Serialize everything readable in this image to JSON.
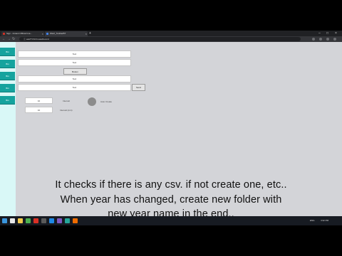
{
  "browser": {
    "tabs": [
      {
        "title": "Sign - Instant Official Ima...",
        "favicon_color": "#d93025"
      },
      {
        "title": "Wet2_ToolbarBT",
        "favicon_color": "#4285f4"
      }
    ],
    "new_tab_glyph": "+",
    "close_glyph": "×",
    "window_controls": [
      "–",
      "□",
      "×"
    ],
    "address": "ⓘ ask/ITCN/CreateRecord",
    "nav_glyphs": [
      "←",
      "→",
      "↻"
    ]
  },
  "app": {
    "sidebar": {
      "buttons": [
        "Btn",
        "Btn",
        "Btn",
        "Btn",
        "Btn"
      ],
      "accent": "#15a39e",
      "background": "#d9f8f7"
    },
    "fields": [
      "Text",
      "Text",
      "Text",
      "Text"
    ],
    "middle_button": "Button",
    "side_button": "Send",
    "small_fields": [
      {
        "value": "10",
        "label": "Interval"
      },
      {
        "value": "10",
        "label": "Interval (min)"
      }
    ],
    "indicator_label": "Auto Create"
  },
  "caption": {
    "lines": [
      "It checks if there is any csv. if not create one, etc..",
      "When year has changed, create new folder with",
      "new year name in the end.."
    ]
  },
  "taskbar": {
    "icon_colors": [
      "#3a96dd",
      "#e8e8e8",
      "#f2c94c",
      "#4caf50",
      "#d93025",
      "#5a5a5a",
      "#1e88e5",
      "#7e57c2",
      "#26a69a",
      "#ef6c00"
    ],
    "clock": "4:32 PM",
    "language": "ENG"
  }
}
